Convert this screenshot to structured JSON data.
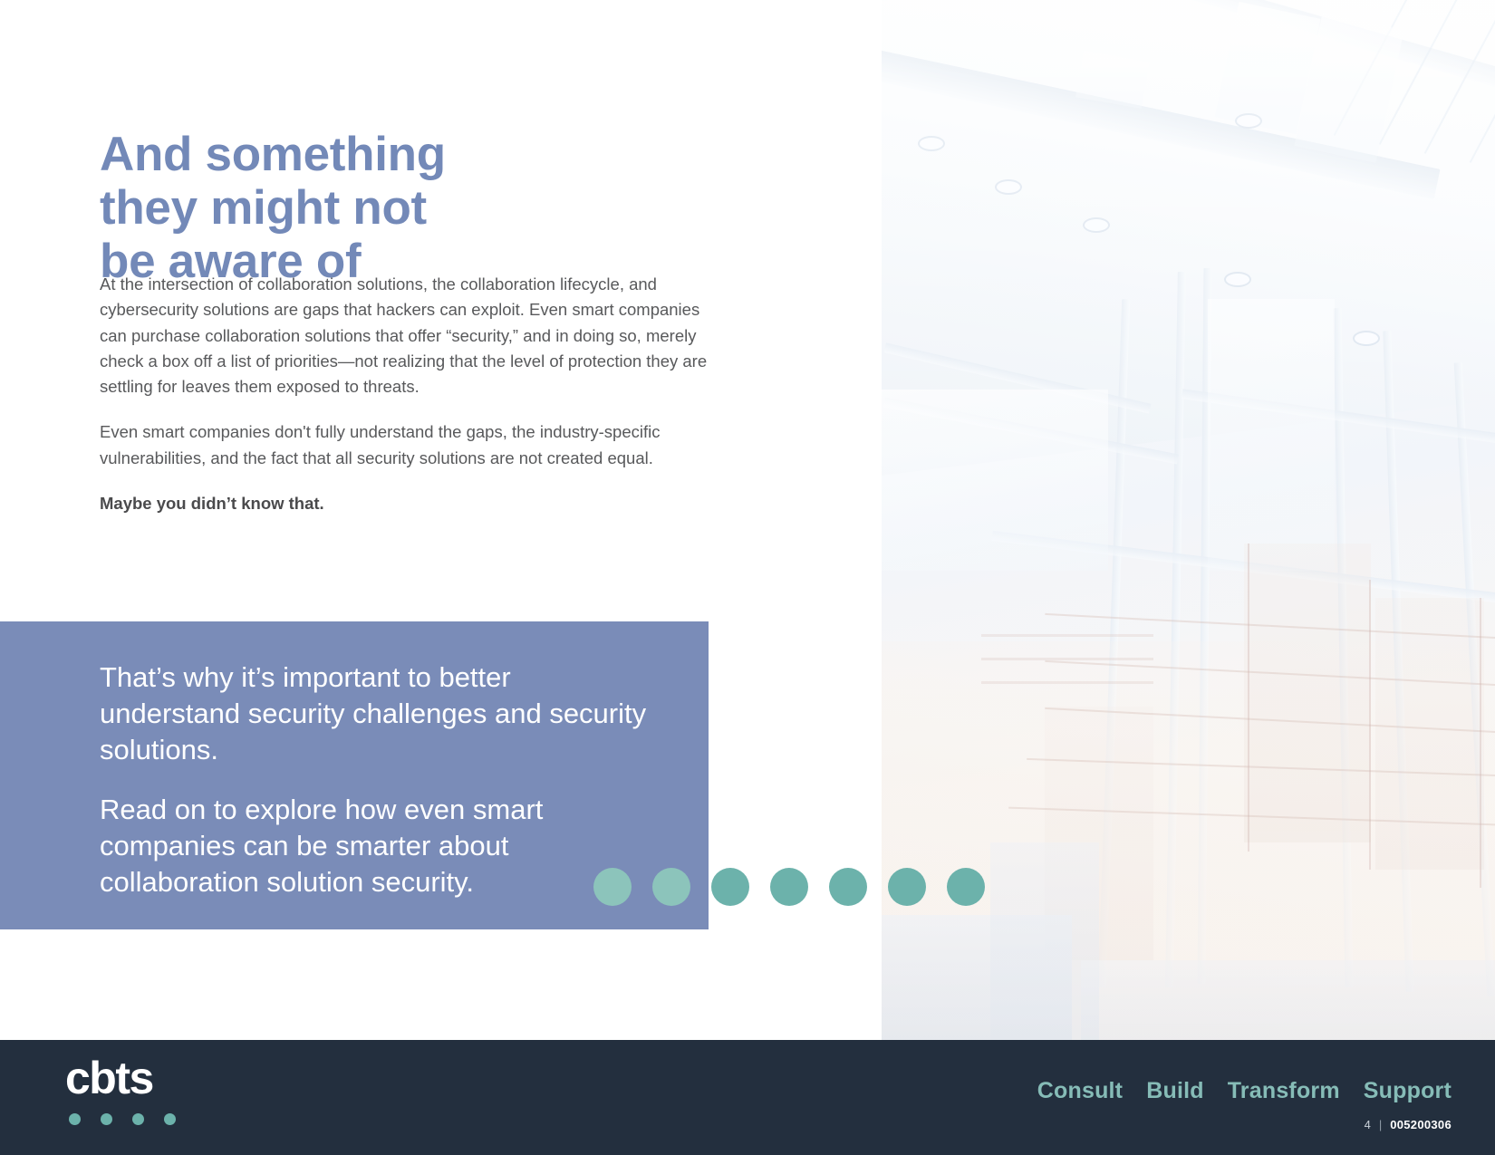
{
  "colors": {
    "heading": "#7389b8",
    "callout_bg": "#7a8cb8",
    "teal": "#6cb2ab",
    "footer_bg": "#232f3e",
    "body_text": "#58595b"
  },
  "heading": {
    "line1": "And something",
    "line2": "they might not",
    "line3": "be aware of"
  },
  "body": {
    "paragraph1": "At the intersection of collaboration solutions, the collaboration lifecycle, and cybersecurity solutions are gaps that hackers can exploit. Even smart companies can purchase collaboration solutions that offer “security,” and in doing so, merely check a box off a list of priorities—not realizing that the level of protection they are settling for leaves them exposed to threats.",
    "paragraph2": "Even smart companies don't fully understand the gaps, the industry-specific vulnerabilities, and the fact that all security solutions are not created equal.",
    "paragraph3": "Maybe you didn’t know that."
  },
  "callout": {
    "paragraph1": "That’s why it’s important to better understand security challenges and security solutions.",
    "paragraph2": "Read on to explore how even smart companies can be smarter about collaboration solution security."
  },
  "dots": {
    "count": 7,
    "on_blue_count": 2
  },
  "footer": {
    "logo": "cbts",
    "logo_dot_count": 4,
    "nav": [
      {
        "label": "Consult"
      },
      {
        "label": "Build"
      },
      {
        "label": "Transform"
      },
      {
        "label": "Support"
      }
    ],
    "page_number": "4",
    "separator": "|",
    "document_code": "005200306"
  },
  "photo": {
    "alt": "office-interior-windows-photo"
  }
}
